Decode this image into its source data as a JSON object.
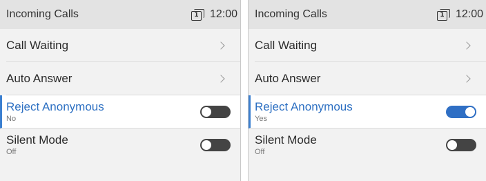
{
  "screens": [
    {
      "header": {
        "title": "Incoming Calls",
        "line_badge": "1",
        "time": "12:00"
      },
      "items": [
        {
          "label": "Call Waiting"
        },
        {
          "label": "Auto Answer"
        },
        {
          "label": "Reject Anonymous",
          "value": "No",
          "toggle_on": false,
          "selected": true
        },
        {
          "label": "Silent Mode",
          "value": "Off",
          "toggle_on": false
        }
      ]
    },
    {
      "header": {
        "title": "Incoming Calls",
        "line_badge": "1",
        "time": "12:00"
      },
      "items": [
        {
          "label": "Call Waiting"
        },
        {
          "label": "Auto Answer"
        },
        {
          "label": "Reject Anonymous",
          "value": "Yes",
          "toggle_on": true,
          "selected": true
        },
        {
          "label": "Silent Mode",
          "value": "Off",
          "toggle_on": false
        }
      ]
    }
  ],
  "colors": {
    "accent": "#2f6fc4",
    "selected_text": "#2c6fc2",
    "toggle_off": "#444444"
  }
}
